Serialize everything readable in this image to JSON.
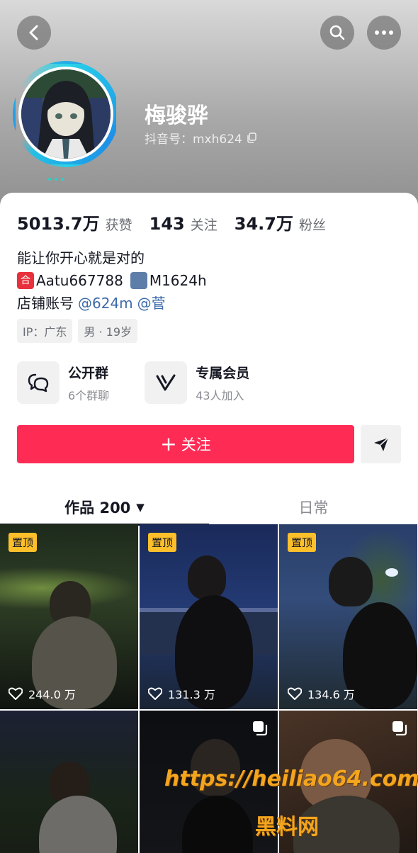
{
  "header": {
    "username": "梅骏骅",
    "handle": "抖音号：mxh624"
  },
  "stats": [
    {
      "value": "5013.7万",
      "label": "获赞"
    },
    {
      "value": "143",
      "label": "关注"
    },
    {
      "value": "34.7万",
      "label": "粉丝"
    }
  ],
  "bio": {
    "line1": "能让你开心就是对的",
    "line2_emoji1": "合",
    "line2_text1": "Aatu667788",
    "line2_text2": "M1624h",
    "line3_prefix": "店铺账号",
    "line3_link1": "@624m",
    "line3_link2": "@菅"
  },
  "tags": [
    "IP：广东",
    "男 · 19岁"
  ],
  "features": [
    {
      "title": "公开群",
      "sub": "6个群聊",
      "icon": "group-chat-icon"
    },
    {
      "title": "专属会员",
      "sub": "43人加入",
      "icon": "vip-icon"
    }
  ],
  "follow_label": "关注",
  "tabs": {
    "works": "作品 200",
    "daily": "日常"
  },
  "videos": [
    {
      "pinned": "置顶",
      "likes": "244.0 万"
    },
    {
      "pinned": "置顶",
      "likes": "131.3 万"
    },
    {
      "pinned": "置顶",
      "likes": "134.6 万"
    },
    {
      "pinned": "",
      "likes": ""
    },
    {
      "pinned": "",
      "likes": ""
    },
    {
      "pinned": "",
      "likes": ""
    }
  ],
  "watermark": {
    "url": "https://heiliao64.com",
    "name": "黑料网"
  },
  "colors": {
    "accent": "#fe2c55",
    "pin": "#fdc02b",
    "link": "#3d6aa8"
  }
}
